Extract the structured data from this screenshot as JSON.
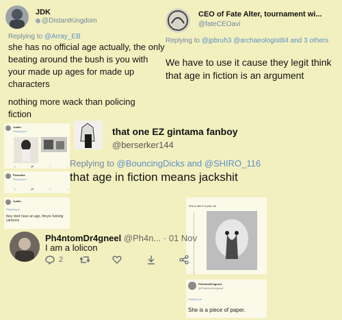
{
  "t1": {
    "name": "JDK",
    "handle": "@DistantKingdom",
    "reply_prefix": "Replying to",
    "reply_to": "@Array_EB",
    "text": "she has no official age actually, the only beating around the bush is you with your made up ages for made up characters",
    "text2": "nothing more wack than policing fiction"
  },
  "t2": {
    "name": "CEO of Fate Alter, tournament wi...",
    "handle": "@fateCEOavi",
    "reply_prefix": "Replying to",
    "reply_to": "@jpbruh3 @archaeologist84 and 3 others",
    "text": "We have to use it cause they legit think that age in fiction is an argument"
  },
  "t3": {
    "name": "that one EZ gintama fanboy",
    "handle": "@berserker144",
    "reply_prefix": "Replying to",
    "reply_to": "@BouncingDicks and @SHIRO_116",
    "text": "that age in fiction means jackshit"
  },
  "t4": {
    "name": "Ph4ntomDr4gneel",
    "handle": "@Ph4n...",
    "time": "· 01 Nov",
    "text": "I am a lolicon",
    "reply_count": "2"
  },
  "small_left": {
    "a_name": "Justin",
    "b_name": "Plesmfoe",
    "c_name": "Justin",
    "c_text": "they dont have an age, theyre fucking cartoons"
  },
  "small_right": {
    "top_text": "She is still a 6 year old",
    "name": "Ph4ntomDr4gneel",
    "handle": "@Ph4ntomDr4gneel",
    "text": "She is a piece of paper."
  },
  "colors": {
    "background": "#f3f0bf",
    "link": "#5a8fc9",
    "handle": "#6f86a3"
  }
}
